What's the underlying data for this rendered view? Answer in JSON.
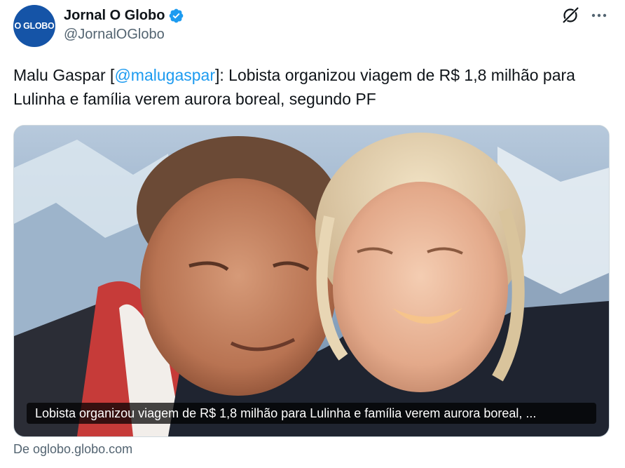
{
  "account": {
    "avatar_text": "O GLOBO",
    "display_name": "Jornal O Globo",
    "handle": "@JornalOGlobo",
    "verified": true
  },
  "header_icons": {
    "grok": "grok-icon",
    "more": "more-icon"
  },
  "tweet": {
    "text_prefix": "Malu Gaspar [",
    "mention": "@malugaspar",
    "text_suffix": "]: Lobista organizou viagem de R$ 1,8 milhão para Lulinha e família verem aurora boreal, segundo PF"
  },
  "link_card": {
    "caption": "Lobista organizou viagem de R$ 1,8 milhão para Lulinha e família verem aurora boreal, ...",
    "source": "De oglobo.globo.com"
  },
  "colors": {
    "link": "#1d9bf0",
    "text": "#0f1419",
    "secondary": "#536471",
    "verified_badge": "#1d9bf0",
    "avatar_bg": "#1554a7"
  }
}
